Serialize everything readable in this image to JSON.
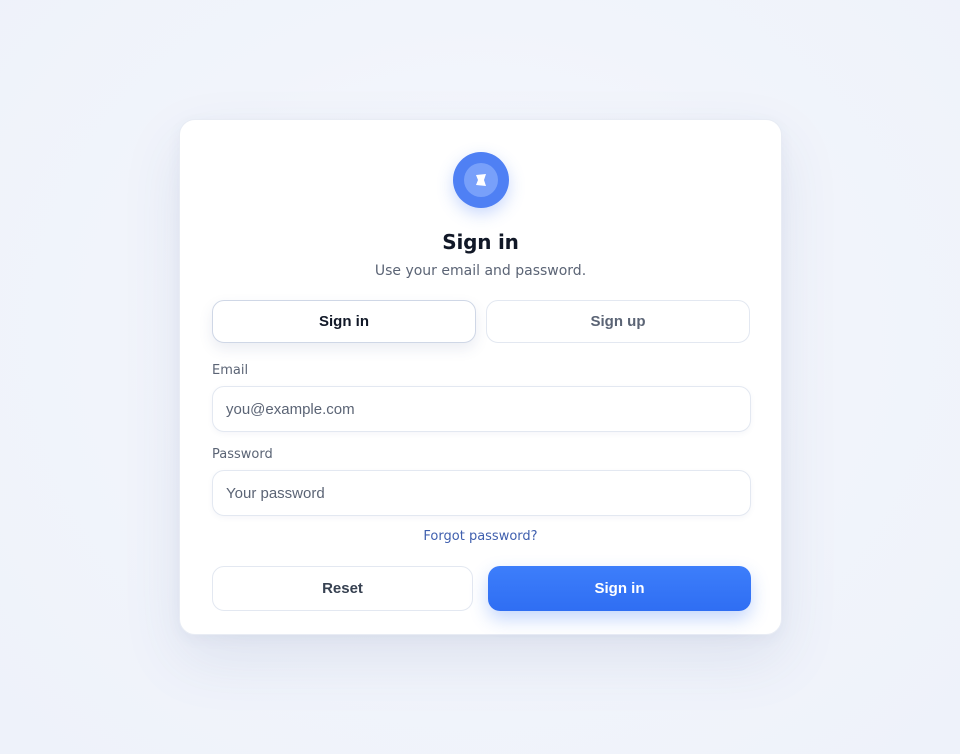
{
  "brand": {
    "logo_icon": "flag-icon",
    "accent_color": "#4f80f4"
  },
  "header": {
    "title": "Sign in",
    "subtitle": "Use your email and password."
  },
  "tabs": [
    {
      "label": "Sign in",
      "active": true
    },
    {
      "label": "Sign up",
      "active": false
    }
  ],
  "form": {
    "email": {
      "label": "Email",
      "placeholder": "you@example.com",
      "value": ""
    },
    "password": {
      "label": "Password",
      "placeholder": "Your password",
      "value": ""
    },
    "forgot_label": "Forgot password?"
  },
  "actions": {
    "reset_label": "Reset",
    "submit_label": "Sign in",
    "submit_color": "#3d7efb"
  }
}
